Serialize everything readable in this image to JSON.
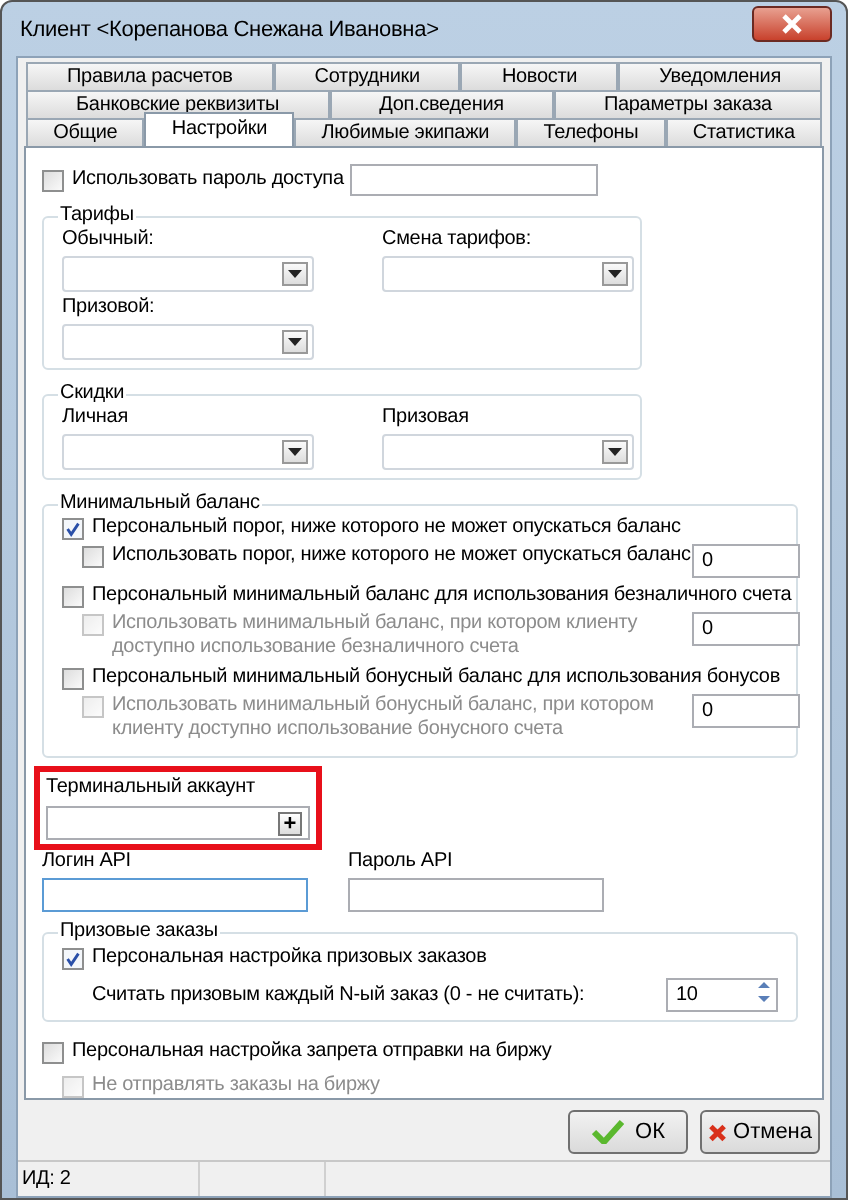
{
  "window": {
    "title": "Клиент <Корепанова Снежана Ивановна>"
  },
  "tab_rows": [
    [
      {
        "label": "Правила расчетов",
        "selected": false
      },
      {
        "label": "Сотрудники",
        "selected": false
      },
      {
        "label": "Новости",
        "selected": false
      },
      {
        "label": "Уведомления",
        "selected": false
      }
    ],
    [
      {
        "label": "Банковские реквизиты",
        "selected": false
      },
      {
        "label": "Доп.сведения",
        "selected": false
      },
      {
        "label": "Параметры заказа",
        "selected": false
      }
    ],
    [
      {
        "label": "Общие",
        "selected": false
      },
      {
        "label": "Настройки",
        "selected": true
      },
      {
        "label": "Любимые экипажи",
        "selected": false
      },
      {
        "label": "Телефоны",
        "selected": false
      },
      {
        "label": "Статистика",
        "selected": false
      }
    ]
  ],
  "access_password": {
    "label": "Использовать пароль доступа",
    "checked": false
  },
  "tariffs": {
    "title": "Тарифы",
    "fields": [
      {
        "label": "Обычный:"
      },
      {
        "label": "Смена тарифов:"
      },
      {
        "label": "Призовой:"
      }
    ]
  },
  "discounts": {
    "title": "Скидки",
    "fields": [
      {
        "label": "Личная"
      },
      {
        "label": "Призовая"
      }
    ]
  },
  "min_balance": {
    "title": "Минимальный баланс",
    "options": [
      {
        "label": "Персональный порог, ниже которого не может опускаться баланс",
        "checked": true,
        "children": [
          {
            "label": "Использовать порог, ниже которого не может опускаться баланс",
            "checked": false,
            "disabled": false,
            "value": "0"
          }
        ]
      },
      {
        "label": "Персональный минимальный баланс для использования безналичного счета",
        "checked": false,
        "children": [
          {
            "label": "Использовать минимальный баланс, при котором клиенту доступно использование безналичного счета",
            "checked": false,
            "disabled": true,
            "value": "0"
          }
        ]
      },
      {
        "label": "Персональный минимальный бонусный баланс для использования бонусов",
        "checked": false,
        "children": [
          {
            "label": "Использовать минимальный бонусный баланс, при котором клиенту доступно использование бонусного счета",
            "checked": false,
            "disabled": true,
            "value": "0"
          }
        ]
      }
    ]
  },
  "terminal_account": {
    "label": "Терминальный аккаунт",
    "button": "+",
    "highlighted": true
  },
  "api": [
    {
      "label": "Логин API",
      "focused": true
    },
    {
      "label": "Пароль API",
      "focused": false
    }
  ],
  "prize_orders": {
    "title": "Призовые заказы",
    "option": {
      "label": "Персональная настройка призовых заказов",
      "checked": true
    },
    "count": {
      "label": "Считать призовым каждый N-ый заказ (0 - не считать):",
      "value": "10"
    }
  },
  "exchange": [
    {
      "label": "Персональная настройка запрета отправки на биржу",
      "checked": false,
      "disabled": false
    },
    {
      "label": "Не отправлять заказы на биржу",
      "checked": false,
      "disabled": true
    }
  ],
  "buttons": [
    {
      "kind": "ok",
      "label": "ОК"
    },
    {
      "kind": "cancel",
      "label": "Отмена"
    }
  ],
  "status_bar": [
    "ИД: 2"
  ]
}
